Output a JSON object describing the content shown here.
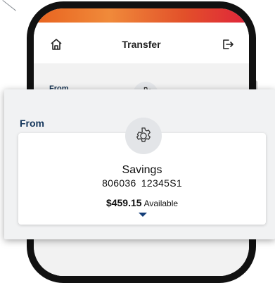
{
  "header": {
    "title": "Transfer",
    "left_icon": "home-icon",
    "right_icon": "logout-icon"
  },
  "background_section": {
    "from_label": "From",
    "icon": "gear-icon"
  },
  "popup": {
    "from_label": "From",
    "account": {
      "icon": "gear-icon",
      "name": "Savings",
      "number": "806036  12345S1",
      "balance": "$459.15",
      "balance_suffix": "Available",
      "expand_icon": "chevron-down-icon"
    }
  },
  "colors": {
    "brand_navy": "#13355a",
    "gradient_orange": "#e8621f",
    "gradient_red": "#e0243b",
    "chevron": "#143e78"
  }
}
